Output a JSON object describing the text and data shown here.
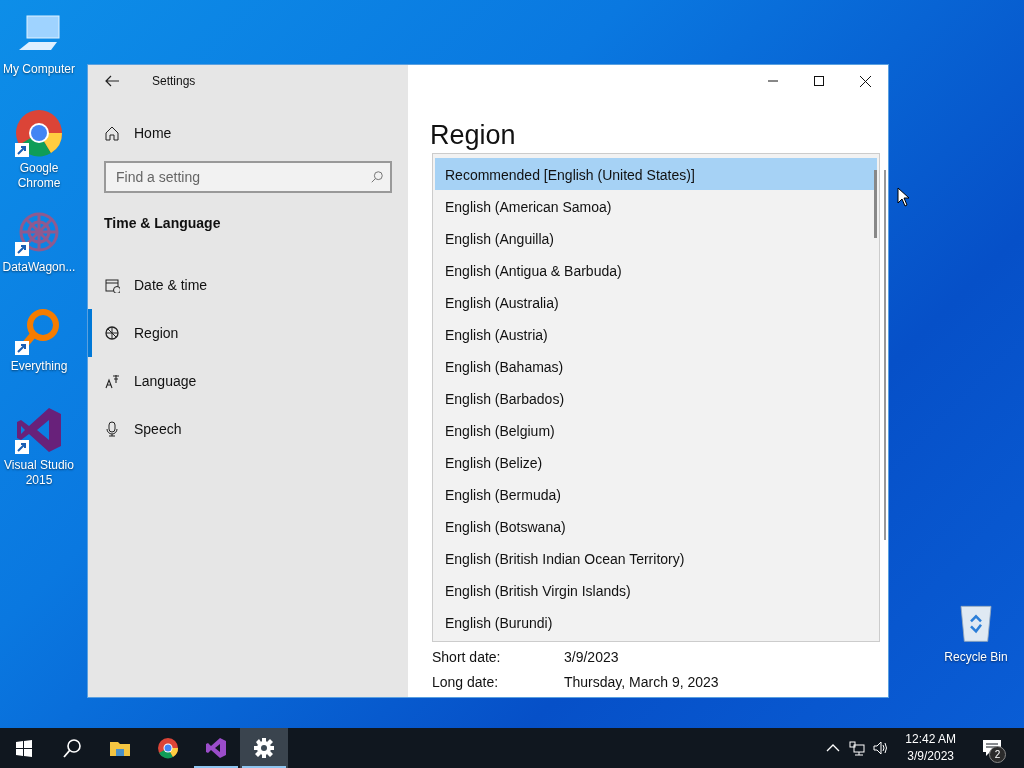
{
  "desktop_icons": [
    {
      "label": "My Computer",
      "kind": "computer",
      "shortcut": false
    },
    {
      "label": "Google Chrome",
      "kind": "chrome",
      "shortcut": true
    },
    {
      "label": "DataWagon...",
      "kind": "datawagon",
      "shortcut": true
    },
    {
      "label": "Everything",
      "kind": "everything",
      "shortcut": true
    },
    {
      "label": "Visual Studio 2015",
      "kind": "vs",
      "shortcut": true
    }
  ],
  "recycle_bin": {
    "label": "Recycle Bin"
  },
  "window": {
    "title": "Settings",
    "sidebar": {
      "home": "Home",
      "search": {
        "placeholder": "Find a setting"
      },
      "section": "Time & Language",
      "items": [
        {
          "label": "Date & time",
          "kind": "calendar",
          "selected": false
        },
        {
          "label": "Region",
          "kind": "globe",
          "selected": true
        },
        {
          "label": "Language",
          "kind": "language",
          "selected": false
        },
        {
          "label": "Speech",
          "kind": "mic",
          "selected": false
        }
      ]
    },
    "page_title": "Region",
    "dropdown": {
      "options": [
        {
          "label": "Recommended [English (United States)]",
          "selected": true
        },
        {
          "label": "English (American Samoa)",
          "selected": false
        },
        {
          "label": "English (Anguilla)",
          "selected": false
        },
        {
          "label": "English (Antigua & Barbuda)",
          "selected": false
        },
        {
          "label": "English (Australia)",
          "selected": false
        },
        {
          "label": "English (Austria)",
          "selected": false
        },
        {
          "label": "English (Bahamas)",
          "selected": false
        },
        {
          "label": "English (Barbados)",
          "selected": false
        },
        {
          "label": "English (Belgium)",
          "selected": false
        },
        {
          "label": "English (Belize)",
          "selected": false
        },
        {
          "label": "English (Bermuda)",
          "selected": false
        },
        {
          "label": "English (Botswana)",
          "selected": false
        },
        {
          "label": "English (British Indian Ocean Territory)",
          "selected": false
        },
        {
          "label": "English (British Virgin Islands)",
          "selected": false
        },
        {
          "label": "English (Burundi)",
          "selected": false
        }
      ]
    },
    "fields": [
      {
        "label": "Short date:",
        "value": "3/9/2023"
      },
      {
        "label": "Long date:",
        "value": "Thursday, March 9, 2023"
      }
    ]
  },
  "taskbar": {
    "apps": [
      {
        "kind": "start",
        "running": false,
        "selected": false
      },
      {
        "kind": "search",
        "running": false,
        "selected": false
      },
      {
        "kind": "explorer",
        "running": false,
        "selected": false
      },
      {
        "kind": "chrome",
        "running": false,
        "selected": false
      },
      {
        "kind": "vs",
        "running": true,
        "selected": false
      },
      {
        "kind": "settings",
        "running": true,
        "selected": true
      }
    ],
    "clock": {
      "time": "12:42 AM",
      "date": "3/9/2023"
    },
    "notifications": "2"
  }
}
